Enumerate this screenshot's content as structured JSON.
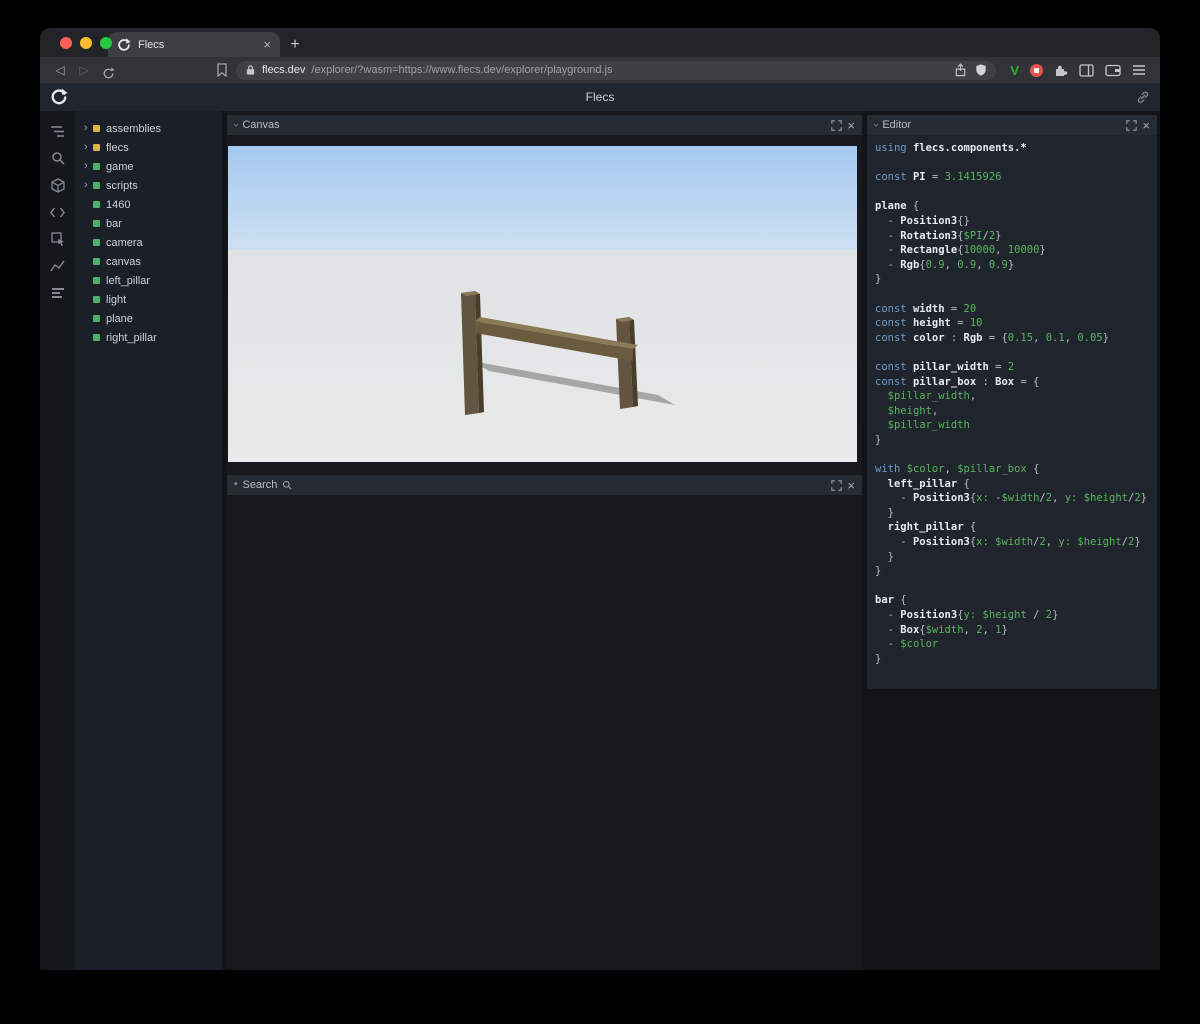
{
  "glyphs": {
    "close": "×",
    "plus": "+",
    "back": "◁",
    "forward": "▷",
    "caret": "›",
    "dot": "•",
    "arrow": "›",
    "vimium": "V"
  },
  "colors": {
    "traffic_red": "#ff5f57",
    "traffic_yellow": "#febc2e",
    "traffic_green": "#28c840",
    "module_yellow": "#dcb440",
    "entity_green": "#4fae68",
    "syntax_keyword": "#6b9bd2",
    "syntax_value": "#58b55e",
    "syntax_identifier": "#e8ebf0",
    "syntax_punct": "#b9bec7",
    "vimium_green": "#2fae2f",
    "ext_red": "#e2574c",
    "sky_top": "#a3c9ef",
    "sky_bottom": "#cfe0f2",
    "ground": "#e6e8e7",
    "shadow": "#a3a8a7",
    "wood_front": "#625440",
    "wood_side": "#493d2c",
    "wood_top": "#8a7a58"
  },
  "browser": {
    "tab_title": "Flecs",
    "url_domain": "flecs.dev",
    "url_path": "/explorer/?wasm=https://www.flecs.dev/explorer/playground.js"
  },
  "header": {
    "title": "Flecs"
  },
  "sidebar_icons": [
    "entity-tree-icon",
    "search-icon",
    "cube-icon",
    "code-icon",
    "inspect-icon",
    "chart-icon",
    "stats-icon"
  ],
  "tree": {
    "items": [
      {
        "label": "assemblies",
        "dot": "yellow",
        "expand": true
      },
      {
        "label": "flecs",
        "dot": "yellow",
        "expand": true
      },
      {
        "label": "game",
        "dot": "green",
        "expand": true
      },
      {
        "label": "scripts",
        "dot": "green",
        "expand": true
      },
      {
        "label": "1460",
        "dot": "green",
        "expand": false
      },
      {
        "label": "bar",
        "dot": "green",
        "expand": false
      },
      {
        "label": "camera",
        "dot": "green",
        "expand": false
      },
      {
        "label": "canvas",
        "dot": "green",
        "expand": false
      },
      {
        "label": "left_pillar",
        "dot": "green",
        "expand": false
      },
      {
        "label": "light",
        "dot": "green",
        "expand": false
      },
      {
        "label": "plane",
        "dot": "green",
        "expand": false
      },
      {
        "label": "right_pillar",
        "dot": "green",
        "expand": false
      }
    ]
  },
  "panels": {
    "canvas": {
      "title": "Canvas"
    },
    "search": {
      "title": "Search"
    },
    "editor": {
      "title": "Editor"
    }
  },
  "editor": {
    "code_lines": [
      [
        [
          "kw",
          "using"
        ],
        [
          "pl",
          " "
        ],
        [
          "id",
          "flecs.components.*"
        ]
      ],
      [],
      [
        [
          "kw",
          "const"
        ],
        [
          "pl",
          " "
        ],
        [
          "id",
          "PI"
        ],
        [
          "pun",
          " = "
        ],
        [
          "num",
          "3.1415926"
        ]
      ],
      [],
      [
        [
          "id",
          "plane"
        ],
        [
          "pun",
          " {"
        ]
      ],
      [
        [
          "pun",
          "  - "
        ],
        [
          "id",
          "Position3"
        ],
        [
          "pun",
          "{}"
        ]
      ],
      [
        [
          "pun",
          "  - "
        ],
        [
          "id",
          "Rotation3"
        ],
        [
          "pun",
          "{"
        ],
        [
          "var",
          "$PI"
        ],
        [
          "pun",
          "/"
        ],
        [
          "num",
          "2"
        ],
        [
          "pun",
          "}"
        ]
      ],
      [
        [
          "pun",
          "  - "
        ],
        [
          "id",
          "Rectangle"
        ],
        [
          "pun",
          "{"
        ],
        [
          "num",
          "10000"
        ],
        [
          "pun",
          ", "
        ],
        [
          "num",
          "10000"
        ],
        [
          "pun",
          "}"
        ]
      ],
      [
        [
          "pun",
          "  - "
        ],
        [
          "id",
          "Rgb"
        ],
        [
          "pun",
          "{"
        ],
        [
          "num",
          "0.9"
        ],
        [
          "pun",
          ", "
        ],
        [
          "num",
          "0.9"
        ],
        [
          "pun",
          ", "
        ],
        [
          "num",
          "0.9"
        ],
        [
          "pun",
          "}"
        ]
      ],
      [
        [
          "pun",
          "}"
        ]
      ],
      [],
      [
        [
          "kw",
          "const"
        ],
        [
          "pl",
          " "
        ],
        [
          "id",
          "width"
        ],
        [
          "pun",
          " = "
        ],
        [
          "num",
          "20"
        ]
      ],
      [
        [
          "kw",
          "const"
        ],
        [
          "pl",
          " "
        ],
        [
          "id",
          "height"
        ],
        [
          "pun",
          " = "
        ],
        [
          "num",
          "10"
        ]
      ],
      [
        [
          "kw",
          "const"
        ],
        [
          "pl",
          " "
        ],
        [
          "id",
          "color"
        ],
        [
          "pun",
          " : "
        ],
        [
          "id",
          "Rgb"
        ],
        [
          "pun",
          " = {"
        ],
        [
          "num",
          "0.15"
        ],
        [
          "pun",
          ", "
        ],
        [
          "num",
          "0.1"
        ],
        [
          "pun",
          ", "
        ],
        [
          "num",
          "0.05"
        ],
        [
          "pun",
          "}"
        ]
      ],
      [],
      [
        [
          "kw",
          "const"
        ],
        [
          "pl",
          " "
        ],
        [
          "id",
          "pillar_width"
        ],
        [
          "pun",
          " = "
        ],
        [
          "num",
          "2"
        ]
      ],
      [
        [
          "kw",
          "const"
        ],
        [
          "pl",
          " "
        ],
        [
          "id",
          "pillar_box"
        ],
        [
          "pun",
          " : "
        ],
        [
          "id",
          "Box"
        ],
        [
          "pun",
          " = {"
        ]
      ],
      [
        [
          "pl",
          "  "
        ],
        [
          "var",
          "$pillar_width"
        ],
        [
          "pun",
          ","
        ]
      ],
      [
        [
          "pl",
          "  "
        ],
        [
          "var",
          "$height"
        ],
        [
          "pun",
          ","
        ]
      ],
      [
        [
          "pl",
          "  "
        ],
        [
          "var",
          "$pillar_width"
        ]
      ],
      [
        [
          "pun",
          "}"
        ]
      ],
      [],
      [
        [
          "kw",
          "with"
        ],
        [
          "pl",
          " "
        ],
        [
          "var",
          "$color"
        ],
        [
          "pun",
          ", "
        ],
        [
          "var",
          "$pillar_box"
        ],
        [
          "pun",
          " {"
        ]
      ],
      [
        [
          "pl",
          "  "
        ],
        [
          "id",
          "left_pillar"
        ],
        [
          "pun",
          " {"
        ]
      ],
      [
        [
          "pun",
          "    - "
        ],
        [
          "id",
          "Position3"
        ],
        [
          "pun",
          "{"
        ],
        [
          "mem",
          "x:"
        ],
        [
          "pl",
          " "
        ],
        [
          "pun",
          "-"
        ],
        [
          "var",
          "$width"
        ],
        [
          "pun",
          "/"
        ],
        [
          "num",
          "2"
        ],
        [
          "pun",
          ", "
        ],
        [
          "mem",
          "y:"
        ],
        [
          "pl",
          " "
        ],
        [
          "var",
          "$height"
        ],
        [
          "pun",
          "/"
        ],
        [
          "num",
          "2"
        ],
        [
          "pun",
          "}"
        ]
      ],
      [
        [
          "pl",
          "  "
        ],
        [
          "pun",
          "}"
        ]
      ],
      [
        [
          "pl",
          "  "
        ],
        [
          "id",
          "right_pillar"
        ],
        [
          "pun",
          " {"
        ]
      ],
      [
        [
          "pun",
          "    - "
        ],
        [
          "id",
          "Position3"
        ],
        [
          "pun",
          "{"
        ],
        [
          "mem",
          "x:"
        ],
        [
          "pl",
          " "
        ],
        [
          "var",
          "$width"
        ],
        [
          "pun",
          "/"
        ],
        [
          "num",
          "2"
        ],
        [
          "pun",
          ", "
        ],
        [
          "mem",
          "y:"
        ],
        [
          "pl",
          " "
        ],
        [
          "var",
          "$height"
        ],
        [
          "pun",
          "/"
        ],
        [
          "num",
          "2"
        ],
        [
          "pun",
          "}"
        ]
      ],
      [
        [
          "pl",
          "  "
        ],
        [
          "pun",
          "}"
        ]
      ],
      [
        [
          "pun",
          "}"
        ]
      ],
      [],
      [
        [
          "id",
          "bar"
        ],
        [
          "pun",
          " {"
        ]
      ],
      [
        [
          "pun",
          "  - "
        ],
        [
          "id",
          "Position3"
        ],
        [
          "pun",
          "{"
        ],
        [
          "mem",
          "y:"
        ],
        [
          "pl",
          " "
        ],
        [
          "var",
          "$height"
        ],
        [
          "pun",
          " / "
        ],
        [
          "num",
          "2"
        ],
        [
          "pun",
          "}"
        ]
      ],
      [
        [
          "pun",
          "  - "
        ],
        [
          "id",
          "Box"
        ],
        [
          "pun",
          "{"
        ],
        [
          "var",
          "$width"
        ],
        [
          "pun",
          ", "
        ],
        [
          "num",
          "2"
        ],
        [
          "pun",
          ", "
        ],
        [
          "num",
          "1"
        ],
        [
          "pun",
          "}"
        ]
      ],
      [
        [
          "pun",
          "  - "
        ],
        [
          "var",
          "$color"
        ]
      ],
      [
        [
          "pun",
          "}"
        ]
      ]
    ]
  }
}
